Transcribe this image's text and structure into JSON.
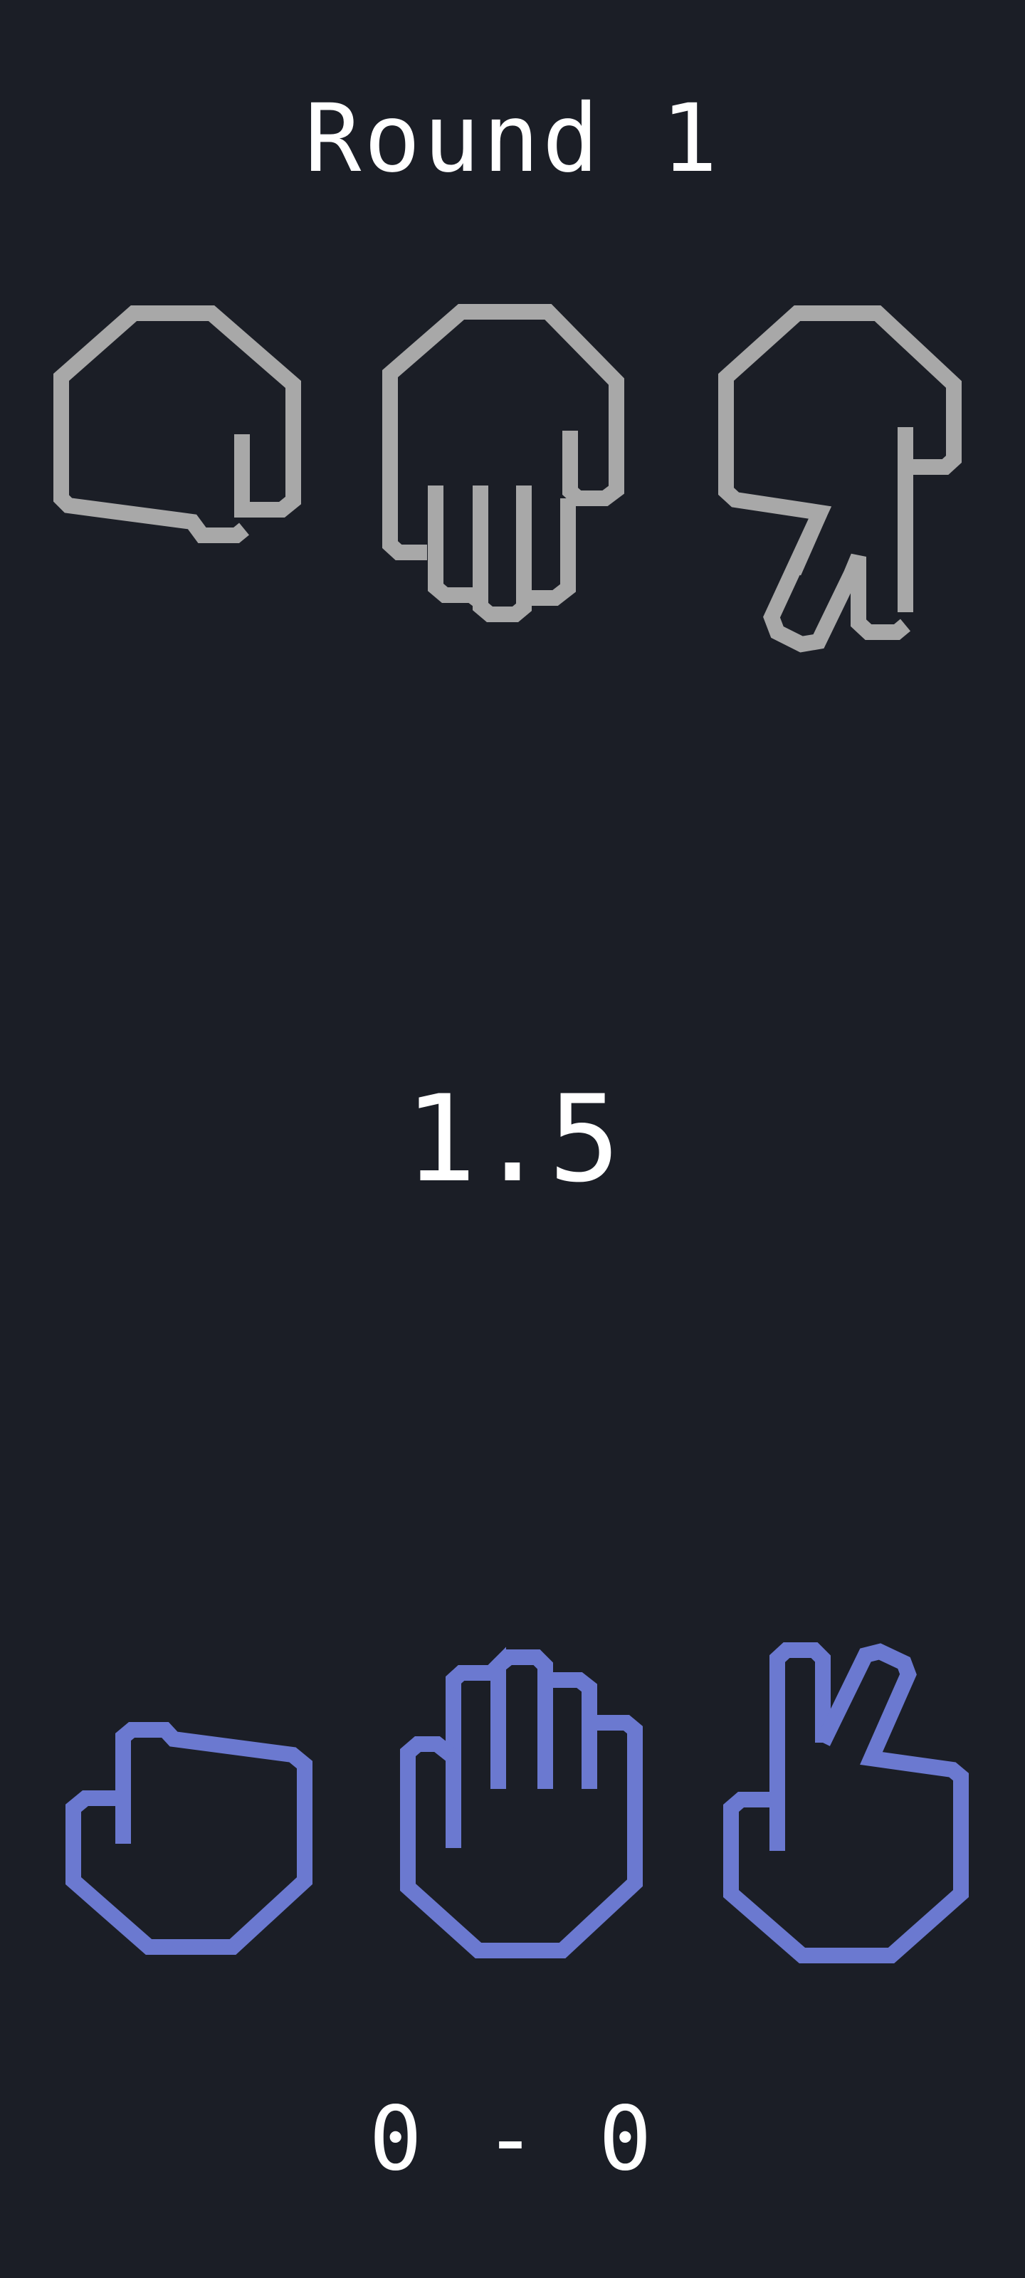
{
  "round": {
    "label": "Round 1"
  },
  "timer": {
    "value": "1.5"
  },
  "score": {
    "text": "0 - 0"
  },
  "opponent": {
    "color": "#a8a8a8",
    "hands": [
      {
        "name": "rock",
        "icon": "rock-hand-icon"
      },
      {
        "name": "paper",
        "icon": "paper-hand-icon"
      },
      {
        "name": "scissors",
        "icon": "scissors-hand-icon"
      }
    ]
  },
  "player": {
    "color": "#6b79d0",
    "hands": [
      {
        "name": "rock",
        "icon": "rock-hand-icon"
      },
      {
        "name": "paper",
        "icon": "paper-hand-icon"
      },
      {
        "name": "scissors",
        "icon": "scissors-hand-icon"
      }
    ]
  }
}
